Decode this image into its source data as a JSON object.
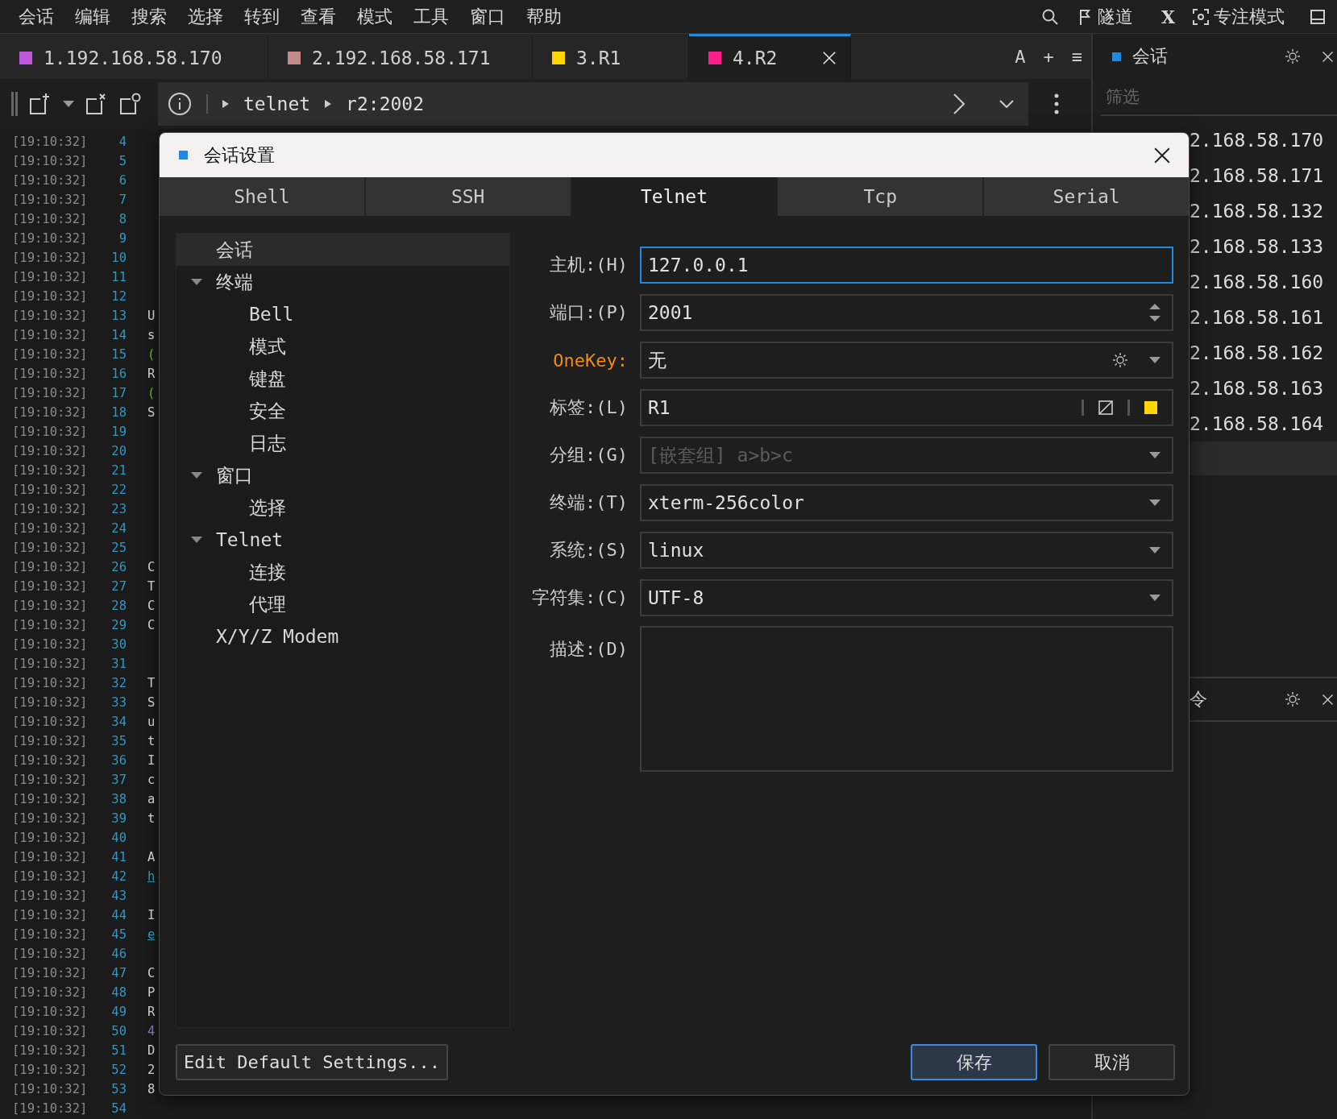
{
  "menu_bar": {
    "items": [
      "会话",
      "编辑",
      "搜索",
      "选择",
      "转到",
      "查看",
      "模式",
      "工具",
      "窗口",
      "帮助"
    ],
    "right_items": [
      {
        "kind": "search"
      },
      {
        "kind": "tunnel",
        "label": "隧道"
      },
      {
        "kind": "text",
        "label": "X"
      },
      {
        "kind": "focus",
        "label": "专注模式"
      },
      {
        "kind": "window"
      }
    ]
  },
  "tabs": [
    {
      "label": "1.192.168.58.170",
      "color": "#c158dc",
      "selected": false
    },
    {
      "label": "2.192.168.58.171",
      "color": "#c48b8b",
      "selected": false
    },
    {
      "label": "3.R1",
      "color": "#ffd600",
      "selected": false
    },
    {
      "label": "4.R2",
      "color": "#ff1c8d",
      "selected": true
    }
  ],
  "tab_actions": [
    "A",
    "+",
    "≡"
  ],
  "toolbar": {
    "path": [
      "telnet",
      "r2:2002"
    ]
  },
  "terminal": {
    "lines": [
      {
        "time": "[19:10:32]",
        "number": "4"
      },
      {
        "time": "[19:10:32]",
        "number": "5"
      },
      {
        "time": "[19:10:32]",
        "number": "6"
      },
      {
        "time": "[19:10:32]",
        "number": "7"
      },
      {
        "time": "[19:10:32]",
        "number": "8"
      },
      {
        "time": "[19:10:32]",
        "number": "9"
      },
      {
        "time": "[19:10:32]",
        "number": "10"
      },
      {
        "time": "[19:10:32]",
        "number": "11"
      },
      {
        "time": "[19:10:32]",
        "number": "12"
      },
      {
        "time": "[19:10:32]",
        "number": "13",
        "text": "U",
        "kind": "plain"
      },
      {
        "time": "[19:10:32]",
        "number": "14",
        "text": "s",
        "kind": "plain"
      },
      {
        "time": "[19:10:32]",
        "number": "15",
        "text": "(",
        "kind": "green"
      },
      {
        "time": "[19:10:32]",
        "number": "16",
        "text": "R",
        "kind": "plain"
      },
      {
        "time": "[19:10:32]",
        "number": "17",
        "text": "(",
        "kind": "green"
      },
      {
        "time": "[19:10:32]",
        "number": "18",
        "text": "S",
        "kind": "plain"
      },
      {
        "time": "[19:10:32]",
        "number": "19"
      },
      {
        "time": "[19:10:32]",
        "number": "20"
      },
      {
        "time": "[19:10:32]",
        "number": "21"
      },
      {
        "time": "[19:10:32]",
        "number": "22"
      },
      {
        "time": "[19:10:32]",
        "number": "23"
      },
      {
        "time": "[19:10:32]",
        "number": "24"
      },
      {
        "time": "[19:10:32]",
        "number": "25"
      },
      {
        "time": "[19:10:32]",
        "number": "26",
        "text": "C",
        "kind": "plain"
      },
      {
        "time": "[19:10:32]",
        "number": "27",
        "text": "T",
        "kind": "plain"
      },
      {
        "time": "[19:10:32]",
        "number": "28",
        "text": "C",
        "kind": "plain"
      },
      {
        "time": "[19:10:32]",
        "number": "29",
        "text": "C",
        "kind": "plain"
      },
      {
        "time": "[19:10:32]",
        "number": "30"
      },
      {
        "time": "[19:10:32]",
        "number": "31"
      },
      {
        "time": "[19:10:32]",
        "number": "32",
        "text": "T",
        "kind": "plain"
      },
      {
        "time": "[19:10:32]",
        "number": "33",
        "text": "S",
        "kind": "plain"
      },
      {
        "time": "[19:10:32]",
        "number": "34",
        "text": "u",
        "kind": "plain"
      },
      {
        "time": "[19:10:32]",
        "number": "35",
        "text": "t",
        "kind": "plain"
      },
      {
        "time": "[19:10:32]",
        "number": "36",
        "text": "I",
        "kind": "plain"
      },
      {
        "time": "[19:10:32]",
        "number": "37",
        "text": "c",
        "kind": "plain"
      },
      {
        "time": "[19:10:32]",
        "number": "38",
        "text": "a",
        "kind": "plain"
      },
      {
        "time": "[19:10:32]",
        "number": "39",
        "text": "t",
        "kind": "plain"
      },
      {
        "time": "[19:10:32]",
        "number": "40"
      },
      {
        "time": "[19:10:32]",
        "number": "41",
        "text": "A",
        "kind": "plain"
      },
      {
        "time": "[19:10:32]",
        "number": "42",
        "text": "h",
        "kind": "link"
      },
      {
        "time": "[19:10:32]",
        "number": "43"
      },
      {
        "time": "[19:10:32]",
        "number": "44",
        "text": "I",
        "kind": "plain"
      },
      {
        "time": "[19:10:32]",
        "number": "45",
        "text": "e",
        "kind": "link"
      },
      {
        "time": "[19:10:32]",
        "number": "46"
      },
      {
        "time": "[19:10:32]",
        "number": "47",
        "text": "C",
        "kind": "plain"
      },
      {
        "time": "[19:10:32]",
        "number": "48",
        "text": "P",
        "kind": "plain"
      },
      {
        "time": "[19:10:32]",
        "number": "49",
        "text": "R",
        "kind": "plain"
      },
      {
        "time": "[19:10:32]",
        "number": "50",
        "text": "4",
        "kind": "purple"
      },
      {
        "time": "[19:10:32]",
        "number": "51",
        "text": "D",
        "kind": "plain"
      },
      {
        "time": "[19:10:32]",
        "number": "52",
        "text": "2",
        "kind": "plain"
      },
      {
        "time": "[19:10:32]",
        "number": "53",
        "text": "8",
        "kind": "plain"
      },
      {
        "time": "[19:10:32]",
        "number": "54"
      }
    ]
  },
  "side_panel": {
    "title": "会话",
    "filter_placeholder": "筛选",
    "sessions": [
      "2.168.58.170",
      "2.168.58.171",
      "2.168.58.132",
      "2.168.58.133",
      "2.168.58.160",
      "2.168.58.161",
      "2.168.58.162",
      "2.168.58.163",
      "2.168.58.164"
    ],
    "highlight_row": true
  },
  "second_panel": {
    "title": "令"
  },
  "dialog": {
    "title": "会话设置",
    "tabs": [
      {
        "label": "Shell",
        "selected": false
      },
      {
        "label": "SSH",
        "selected": false
      },
      {
        "label": "Telnet",
        "selected": true
      },
      {
        "label": "Tcp",
        "selected": false
      },
      {
        "label": "Serial",
        "selected": false
      }
    ],
    "tree": [
      {
        "label": "会话",
        "selected": true
      },
      {
        "label": "终端",
        "selected": false,
        "expanded": true,
        "children": [
          {
            "label": "Bell",
            "selected": false
          },
          {
            "label": "模式",
            "selected": false
          },
          {
            "label": "键盘",
            "selected": false
          },
          {
            "label": "安全",
            "selected": false
          },
          {
            "label": "日志",
            "selected": false
          }
        ]
      },
      {
        "label": "窗口",
        "selected": false,
        "expanded": true,
        "children": [
          {
            "label": "选择",
            "selected": false
          }
        ]
      },
      {
        "label": "Telnet",
        "selected": false,
        "expanded": true,
        "children": [
          {
            "label": "连接",
            "selected": false
          },
          {
            "label": "代理",
            "selected": false
          }
        ]
      },
      {
        "label": "X/Y/Z Modem",
        "selected": false
      }
    ],
    "form": [
      {
        "kind": "text",
        "label": "主机:(H)",
        "value": "127.0.0.1",
        "focused": true,
        "accent": false
      },
      {
        "kind": "spin",
        "label": "端口:(P)",
        "value": "2001",
        "focused": false,
        "accent": false
      },
      {
        "kind": "select",
        "label": "OneKey:",
        "value": "无",
        "gear": true,
        "focused": false,
        "accent": true
      },
      {
        "kind": "tag",
        "label": "标签:(L)",
        "value": "R1",
        "color": "#ffd600",
        "focused": false,
        "accent": false
      },
      {
        "kind": "select",
        "label": "分组:(G)",
        "placeholder": "[嵌套组] a>b>c",
        "gear": false,
        "focused": false,
        "accent": false
      },
      {
        "kind": "select",
        "label": "终端:(T)",
        "value": "xterm-256color",
        "gear": false,
        "focused": false,
        "accent": false
      },
      {
        "kind": "select",
        "label": "系统:(S)",
        "value": "linux",
        "gear": false,
        "focused": false,
        "accent": false
      },
      {
        "kind": "select",
        "label": "字符集:(C)",
        "value": "UTF-8",
        "gear": false,
        "focused": false,
        "accent": false
      },
      {
        "kind": "textarea",
        "label": "描述:(D)",
        "focused": false,
        "accent": false
      }
    ],
    "default_button": "Edit Default Settings...",
    "buttons": [
      {
        "label": "保存",
        "primary": true
      },
      {
        "label": "取消",
        "primary": false
      }
    ]
  }
}
